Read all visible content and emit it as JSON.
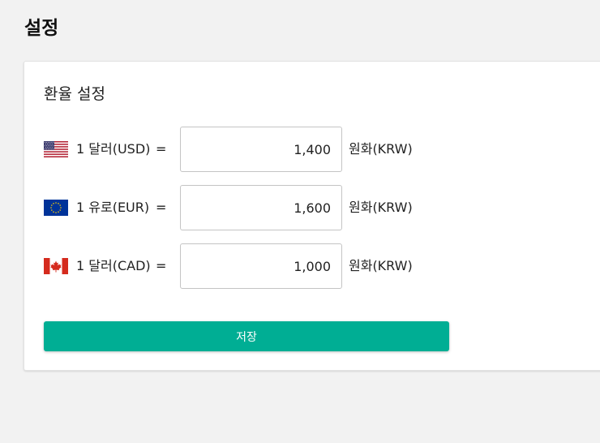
{
  "page": {
    "title": "설정"
  },
  "exchange": {
    "title": "환율 설정",
    "rates": [
      {
        "currency_label": "1 달러(USD)",
        "flag_icon": "us-flag-icon",
        "equals": "=",
        "value": "1,400",
        "unit": "원화(KRW)"
      },
      {
        "currency_label": "1 유로(EUR)",
        "flag_icon": "eu-flag-icon",
        "equals": "=",
        "value": "1,600",
        "unit": "원화(KRW)"
      },
      {
        "currency_label": "1 달러(CAD)",
        "flag_icon": "canada-flag-icon",
        "equals": "=",
        "value": "1,000",
        "unit": "원화(KRW)"
      }
    ],
    "save_label": "저장"
  },
  "colors": {
    "accent": "#00ae94",
    "background": "#f2f2f2",
    "card": "#ffffff"
  }
}
